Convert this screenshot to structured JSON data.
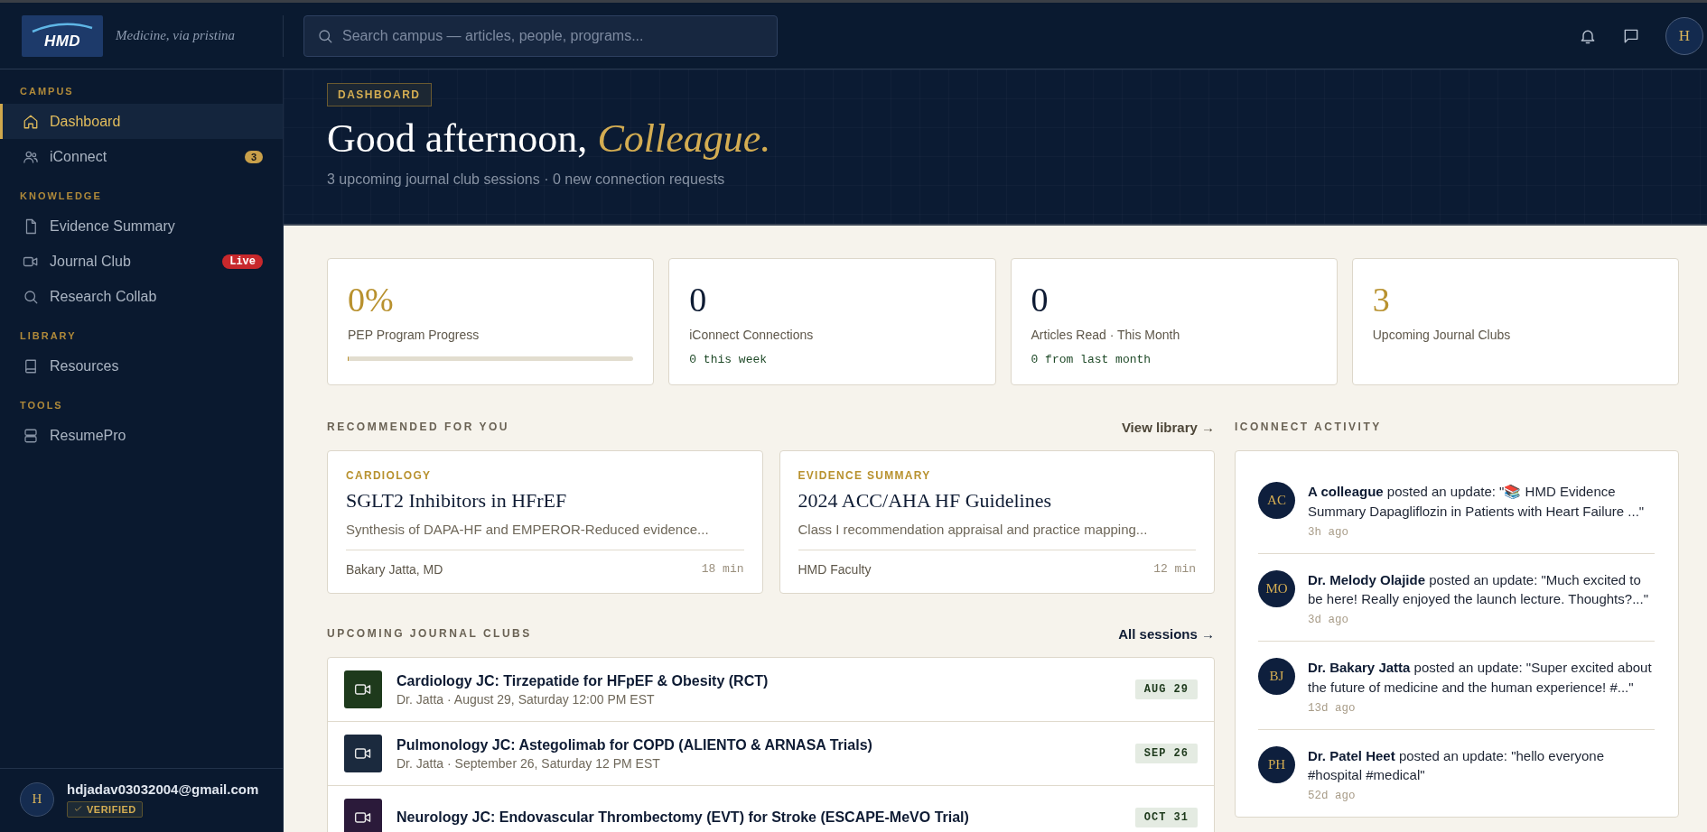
{
  "topbar": {
    "logo": "HMD",
    "tagline": "Medicine, via pristina",
    "search": {
      "placeholder": "Search campus — articles, people, programs..."
    },
    "avatar": "H"
  },
  "sidebar": {
    "sections": [
      {
        "title": "CAMPUS",
        "items": [
          {
            "label": "Dashboard",
            "kind": "home",
            "selected": true
          },
          {
            "label": "iConnect",
            "kind": "users",
            "selected": false,
            "badge": {
              "kind": "count",
              "text": "3"
            }
          }
        ]
      },
      {
        "title": "KNOWLEDGE",
        "items": [
          {
            "label": "Evidence Summary",
            "kind": "file",
            "selected": false
          },
          {
            "label": "Journal Club",
            "kind": "video",
            "selected": false,
            "badge": {
              "kind": "live",
              "text": "Live"
            }
          },
          {
            "label": "Research Collab",
            "kind": "search",
            "selected": false
          }
        ]
      },
      {
        "title": "LIBRARY",
        "items": [
          {
            "label": "Resources",
            "kind": "book",
            "selected": false
          }
        ]
      },
      {
        "title": "TOOLS",
        "items": [
          {
            "label": "ResumePro",
            "kind": "stack",
            "selected": false
          }
        ]
      }
    ],
    "user": {
      "avatar": "H",
      "email": "hdjadav03032004@gmail.com",
      "verified": "VERIFIED"
    }
  },
  "hero": {
    "tag": "DASHBOARD",
    "greeting": "Good afternoon, *Colleague.*",
    "subtitle": "3 upcoming journal club sessions · 0 new connection requests"
  },
  "stats": [
    {
      "kind": "progress",
      "value": "0%",
      "label": "PEP Program Progress",
      "highlight": true,
      "level": 0
    },
    {
      "kind": "note",
      "value": "0",
      "label": "iConnect Connections",
      "highlight": false,
      "note": "0 this week"
    },
    {
      "kind": "note",
      "value": "0",
      "label": "Articles Read · This Month",
      "highlight": false,
      "note": "0 from last month"
    },
    {
      "kind": "plain",
      "value": "3",
      "label": "Upcoming Journal Clubs",
      "highlight": true
    }
  ],
  "recommended": {
    "title": "RECOMMENDED FOR YOU",
    "link": "View library →",
    "cards": [
      {
        "category": "CARDIOLOGY",
        "title": "SGLT2 Inhibitors in HFrEF",
        "summary": "Synthesis of DAPA-HF and EMPEROR-Reduced evidence...",
        "author": "Bakary Jatta, MD",
        "duration": "18 min"
      },
      {
        "category": "EVIDENCE SUMMARY",
        "title": "2024 ACC/AHA HF Guidelines",
        "summary": "Class I recommendation appraisal and practice mapping...",
        "author": "HMD Faculty",
        "duration": "12 min"
      }
    ]
  },
  "journal_clubs": {
    "title": "UPCOMING JOURNAL CLUBS",
    "link": "All sessions →",
    "sessions": [
      {
        "title": "Cardiology JC: Tirzepatide for HFpEF & Obesity (RCT)",
        "meta": "Dr. Jatta · August 29, Saturday 12:00 PM EST",
        "date": "AUG 29",
        "color": "#1e3a1c"
      },
      {
        "title": "Pulmonology JC: Astegolimab for COPD (ALIENTO & ARNASA Trials)",
        "meta": "Dr. Jatta · September 26, Saturday 12 PM EST",
        "date": "SEP 26",
        "color": "#1b2a3e"
      },
      {
        "title": "Neurology JC: Endovascular Thrombectomy (EVT) for Stroke (ESCAPE-MeVO Trial)",
        "date": "OCT 31",
        "color": "#2b1a3a"
      }
    ]
  },
  "activity": {
    "title": "ICONNECT ACTIVITY",
    "items": [
      {
        "initials": "AC",
        "text": "**A colleague** posted an update: \"📚 HMD Evidence Summary Dapagliflozin in Patients with Heart Failure ...\"",
        "time": "3h ago"
      },
      {
        "initials": "MO",
        "text": "**Dr. Melody Olajide** posted an update: \"Much excited to be here! Really enjoyed the launch lecture. Thoughts?...\"",
        "time": "3d ago"
      },
      {
        "initials": "BJ",
        "text": "**Dr. Bakary Jatta** posted an update: \"Super excited about the future of medicine and the human experience! #...\"",
        "time": "13d ago"
      },
      {
        "initials": "PH",
        "text": "**Dr. Patel Heet** posted an update: \"hello everyone #hospital #medical\"",
        "time": "52d ago"
      }
    ]
  }
}
